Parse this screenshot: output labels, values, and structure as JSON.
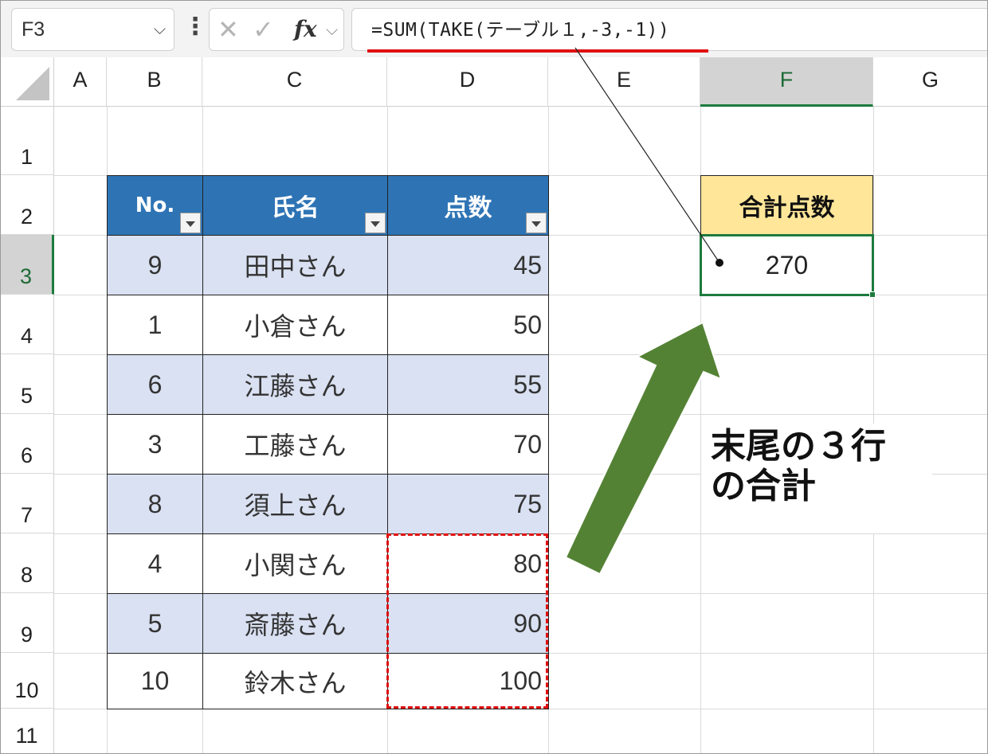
{
  "name_box": {
    "value": "F3"
  },
  "formula_bar": {
    "formula": "=SUM(TAKE(テーブル１,-3,-1))"
  },
  "columns": [
    "A",
    "B",
    "C",
    "D",
    "E",
    "F",
    "G"
  ],
  "rows": [
    "1",
    "2",
    "3",
    "4",
    "5",
    "6",
    "7",
    "8",
    "9",
    "10",
    "11"
  ],
  "table": {
    "headers": [
      "No.",
      "氏名",
      "点数"
    ],
    "rows": [
      [
        "9",
        "田中さん",
        "45"
      ],
      [
        "1",
        "小倉さん",
        "50"
      ],
      [
        "6",
        "江藤さん",
        "55"
      ],
      [
        "3",
        "工藤さん",
        "70"
      ],
      [
        "8",
        "須上さん",
        "75"
      ],
      [
        "4",
        "小関さん",
        "80"
      ],
      [
        "5",
        "斎藤さん",
        "90"
      ],
      [
        "10",
        "鈴木さん",
        "100"
      ]
    ]
  },
  "total": {
    "label": "合計点数",
    "value": "270"
  },
  "annotation": {
    "line1": "末尾の３行",
    "line2": "の合計"
  },
  "colors": {
    "table_header": "#2e74b5",
    "band": "#d9e1f2",
    "total_header": "#ffe699",
    "selection": "#1d7a3d",
    "arrow": "#548235",
    "highlight": "#e01010"
  }
}
